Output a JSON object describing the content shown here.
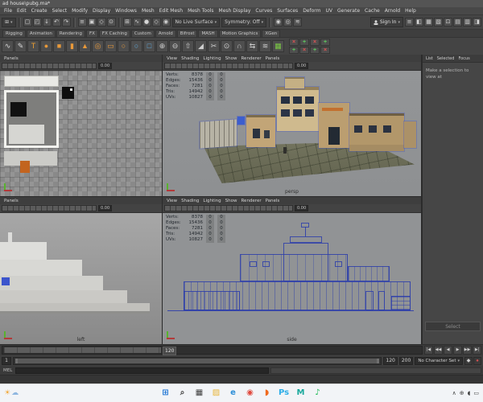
{
  "window": {
    "title": "ad house\\pubg.ma*"
  },
  "menu_bar": {
    "items": [
      "File",
      "Edit",
      "Create",
      "Select",
      "Modify",
      "Display",
      "Windows",
      "Mesh",
      "Edit Mesh",
      "Mesh Tools",
      "Mesh Display",
      "Curves",
      "Surfaces",
      "Deform",
      "UV",
      "Generate",
      "Cache",
      "Arnold",
      "Help"
    ]
  },
  "icons": {
    "chevron_down": "▾",
    "menu_grid": "⊞",
    "sun": "☀",
    "cloud": "☁"
  },
  "status_line": {
    "live_surface_label": "No Live Surface",
    "symmetry_label": "Symmetry: Off",
    "sign_in_label": "Sign In",
    "left_icons": [
      {
        "name": "new-scene-icon",
        "glyph": "▢"
      },
      {
        "name": "open-scene-icon",
        "glyph": "◰"
      },
      {
        "name": "save-scene-icon",
        "glyph": "↓"
      },
      {
        "name": "undo-icon",
        "glyph": "↶"
      },
      {
        "name": "redo-icon",
        "glyph": "↷"
      }
    ],
    "selection_icons": [
      {
        "name": "select-by-hierarchy-icon",
        "glyph": "≡"
      },
      {
        "name": "select-by-object-icon",
        "glyph": "▣"
      },
      {
        "name": "select-by-component-icon",
        "glyph": "◇"
      },
      {
        "name": "highlight-selection-icon",
        "glyph": "⊙"
      }
    ],
    "snap_icons": [
      {
        "name": "snap-to-grid-icon",
        "glyph": "⊞"
      },
      {
        "name": "snap-to-curve-icon",
        "glyph": "∿"
      },
      {
        "name": "snap-to-point-icon",
        "glyph": "●"
      },
      {
        "name": "snap-to-plane-icon",
        "glyph": "◇"
      },
      {
        "name": "make-live-icon",
        "glyph": "◉"
      }
    ],
    "render_icons": [
      {
        "name": "render-current-frame-icon",
        "glyph": "◉"
      },
      {
        "name": "ipr-render-icon",
        "glyph": "◎"
      },
      {
        "name": "render-settings-icon",
        "glyph": "≋"
      }
    ],
    "right_icons": [
      {
        "name": "outliner-toggle-icon",
        "glyph": "≡"
      },
      {
        "name": "modeling-toolkit-toggle-icon",
        "glyph": "◧"
      },
      {
        "name": "uv-editor-toggle-icon",
        "glyph": "▦"
      },
      {
        "name": "xgen-toggle-icon",
        "glyph": "▧"
      },
      {
        "name": "tool-settings-toggle-icon",
        "glyph": "⊡"
      },
      {
        "name": "attribute-editor-toggle-icon",
        "glyph": "▤"
      },
      {
        "name": "channel-box-toggle-icon",
        "glyph": "▥"
      },
      {
        "name": "arnold-toggle-icon",
        "glyph": "◨"
      }
    ]
  },
  "shelf": {
    "tabs": [
      "Rigging",
      "Animation",
      "Rendering",
      "FX",
      "FX Caching",
      "Custom",
      "Arnold",
      "Bifrost",
      "MASH",
      "Motion Graphics",
      "XGen"
    ],
    "icons": [
      {
        "name": "curve-tool-icon",
        "glyph": "∿",
        "color": "#d8d8d8"
      },
      {
        "name": "pencil-curve-icon",
        "glyph": "✎",
        "color": "#d8d8d8"
      },
      {
        "name": "text-tool-icon",
        "glyph": "T",
        "color": "#f0a030"
      },
      {
        "name": "poly-sphere-icon",
        "glyph": "●",
        "color": "#e8993a"
      },
      {
        "name": "poly-cube-icon",
        "glyph": "■",
        "color": "#e8993a"
      },
      {
        "name": "poly-cylinder-icon",
        "glyph": "▮",
        "color": "#e8993a"
      },
      {
        "name": "poly-cone-icon",
        "glyph": "▲",
        "color": "#e8993a"
      },
      {
        "name": "poly-torus-icon",
        "glyph": "◎",
        "color": "#e8993a"
      },
      {
        "name": "poly-plane-icon",
        "glyph": "▭",
        "color": "#e8993a"
      },
      {
        "name": "poly-disc-icon",
        "glyph": "○",
        "color": "#e8993a"
      },
      {
        "name": "nurbs-circle-icon",
        "glyph": "○",
        "color": "#5fb0e8"
      },
      {
        "name": "nurbs-square-icon",
        "glyph": "□",
        "color": "#5fb0e8"
      },
      {
        "name": "boolean-union-icon",
        "glyph": "⊕",
        "color": "#cfcfcf"
      },
      {
        "name": "boolean-difference-icon",
        "glyph": "⊖",
        "color": "#cfcfcf"
      },
      {
        "name": "extrude-icon",
        "glyph": "⇧",
        "color": "#cfcfcf"
      },
      {
        "name": "bevel-icon",
        "glyph": "◢",
        "color": "#cfcfcf"
      },
      {
        "name": "multi-cut-icon",
        "glyph": "✂",
        "color": "#cfcfcf"
      },
      {
        "name": "target-weld-icon",
        "glyph": "⊙",
        "color": "#cfcfcf"
      },
      {
        "name": "bridge-icon",
        "glyph": "∩",
        "color": "#cfcfcf"
      },
      {
        "name": "mirror-icon",
        "glyph": "⇆",
        "color": "#cfcfcf"
      },
      {
        "name": "smooth-icon",
        "glyph": "≋",
        "color": "#cfcfcf"
      },
      {
        "name": "quad-draw-icon",
        "glyph": "▦",
        "color": "#7ac943"
      }
    ],
    "danger_icons": [
      {
        "name": "shelf-delete-icon",
        "glyph": "×",
        "color": "#e05252"
      },
      {
        "name": "shelf-create-icon",
        "glyph": "+",
        "color": "#5ecb5e"
      },
      {
        "name": "shelf-delete-icon",
        "glyph": "×",
        "color": "#e05252"
      },
      {
        "name": "shelf-create-icon",
        "glyph": "+",
        "color": "#5ecb5e"
      },
      {
        "name": "shelf-create-icon",
        "glyph": "+",
        "color": "#5ecb5e"
      },
      {
        "name": "shelf-delete-icon",
        "glyph": "×",
        "color": "#e05252"
      },
      {
        "name": "shelf-create-icon",
        "glyph": "+",
        "color": "#5ecb5e"
      },
      {
        "name": "shelf-delete-icon",
        "glyph": "×",
        "color": "#e05252"
      }
    ]
  },
  "viewports": {
    "menu_full": [
      "View",
      "Shading",
      "Lighting",
      "Show",
      "Renderer",
      "Panels"
    ],
    "menu_compact": [
      "Panels"
    ],
    "exposure": "0.00",
    "persp_label": "persp",
    "left_label": "left",
    "side_label": "side"
  },
  "hud": {
    "rows": [
      {
        "label": "Verts:",
        "value": "8378",
        "a": "0",
        "b": "0"
      },
      {
        "label": "Edges:",
        "value": "15436",
        "a": "0",
        "b": "0"
      },
      {
        "label": "Faces:",
        "value": "7281",
        "a": "0",
        "b": "0"
      },
      {
        "label": "Tris:",
        "value": "14942",
        "a": "0",
        "b": "0"
      },
      {
        "label": "UVs:",
        "value": "10827",
        "a": "0",
        "b": "0"
      }
    ]
  },
  "attribute_editor": {
    "tabs": [
      "List",
      "Selected",
      "Focus"
    ],
    "message": "Make a selection to view at",
    "select_button": "Select"
  },
  "timeline": {
    "current_frame": "120",
    "anim_start": "1",
    "range_start": "120",
    "range_end": "200",
    "character_set": "No Character Set",
    "command_label": "MEL",
    "transport": [
      {
        "name": "go-to-start-button",
        "glyph": "|◀"
      },
      {
        "name": "step-back-frame-button",
        "glyph": "◀◀"
      },
      {
        "name": "play-backwards-button",
        "glyph": "◀"
      },
      {
        "name": "play-button",
        "glyph": "▶"
      },
      {
        "name": "step-forward-frame-button",
        "glyph": "▶▶"
      },
      {
        "name": "go-to-end-button",
        "glyph": "▶|"
      }
    ],
    "key_icons": [
      {
        "name": "set-key-icon",
        "glyph": "◆",
        "color": "#cfcfcf"
      },
      {
        "name": "auto-keyframe-toggle-icon",
        "glyph": "●",
        "color": "#d05050"
      }
    ]
  },
  "taskbar": {
    "apps": [
      {
        "name": "start-button",
        "glyph": "⊞",
        "color": "#1a73d4"
      },
      {
        "name": "search-icon",
        "glyph": "⌕",
        "color": "#3f3f3f"
      },
      {
        "name": "task-view-icon",
        "glyph": "▦",
        "color": "#3f3f3f"
      },
      {
        "name": "file-explorer-icon",
        "glyph": "▨",
        "color": "#e8b53a"
      },
      {
        "name": "edge-icon",
        "glyph": "e",
        "color": "#2e8fd8"
      },
      {
        "name": "chrome-icon",
        "glyph": "◉",
        "color": "#e04a3f"
      },
      {
        "name": "firefox-icon",
        "glyph": "◗",
        "color": "#f06b1f"
      },
      {
        "name": "photoshop-icon",
        "glyph": "Ps",
        "color": "#2daee8"
      },
      {
        "name": "maya-icon",
        "glyph": "M",
        "color": "#19a89c"
      },
      {
        "name": "spotify-icon",
        "glyph": "♪",
        "color": "#1db954"
      }
    ],
    "tray": [
      {
        "name": "tray-chevron-icon",
        "glyph": "∧",
        "color": "#3f3f3f"
      },
      {
        "name": "tray-network-icon",
        "glyph": "⊕",
        "color": "#3f3f3f"
      },
      {
        "name": "tray-volume-icon",
        "glyph": "◖",
        "color": "#3f3f3f"
      },
      {
        "name": "tray-battery-icon",
        "glyph": "▭",
        "color": "#3f3f3f"
      }
    ]
  }
}
